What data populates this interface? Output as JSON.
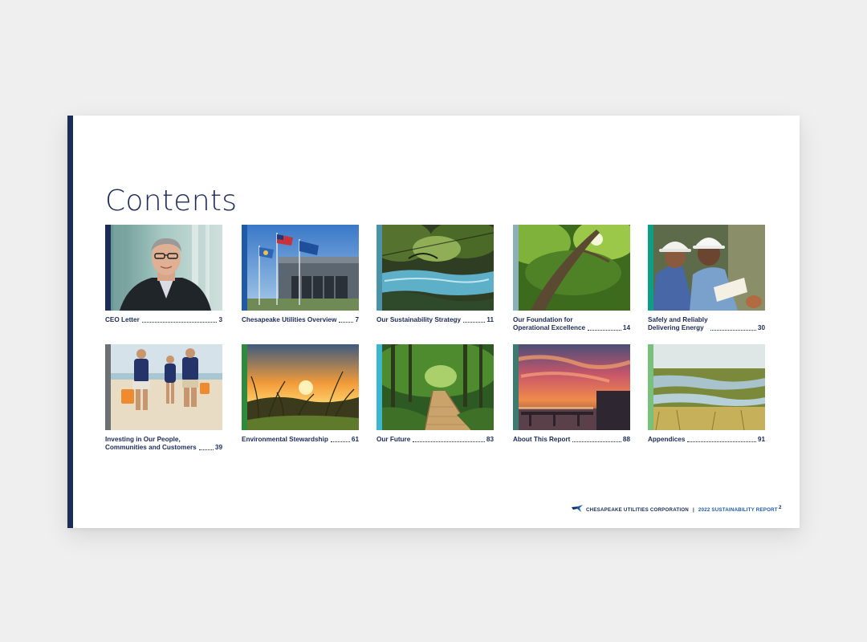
{
  "document": {
    "title": "Contents",
    "colors": {
      "navy": "#1c2b58",
      "report_blue": "#1e5aa8"
    },
    "entries": [
      {
        "label": "CEO Letter",
        "page": "3",
        "accent": "#1c2b58"
      },
      {
        "label": "Chesapeake Utilities Overview",
        "page": "7",
        "accent": "#1f5aa6"
      },
      {
        "label": "Our Sustainability Strategy",
        "page": "11",
        "accent": "#4a93a8"
      },
      {
        "label": "Our Foundation for\nOperational Excellence",
        "page": "14",
        "accent": "#8cb0b8"
      },
      {
        "label": "Safely and Reliably\nDelivering Energy",
        "page": "30",
        "accent": "#0d9f84"
      },
      {
        "label": "Investing in Our People,\nCommunities and Customers",
        "page": "39",
        "accent": "#6e7173"
      },
      {
        "label": "Environmental Stewardship",
        "page": "61",
        "accent": "#2e8b3e"
      },
      {
        "label": "Our Future",
        "page": "83",
        "accent": "#3cb7cf"
      },
      {
        "label": "About This Report",
        "page": "88",
        "accent": "#3c7a72"
      },
      {
        "label": "Appendices",
        "page": "91",
        "accent": "#78c07c"
      }
    ],
    "footer": {
      "company": "CHESAPEAKE UTILITIES CORPORATION",
      "separator": "|",
      "report": "2022 SUSTAINABILITY REPORT",
      "page_number": "2",
      "logo_icon": "bird-logo-icon"
    }
  }
}
